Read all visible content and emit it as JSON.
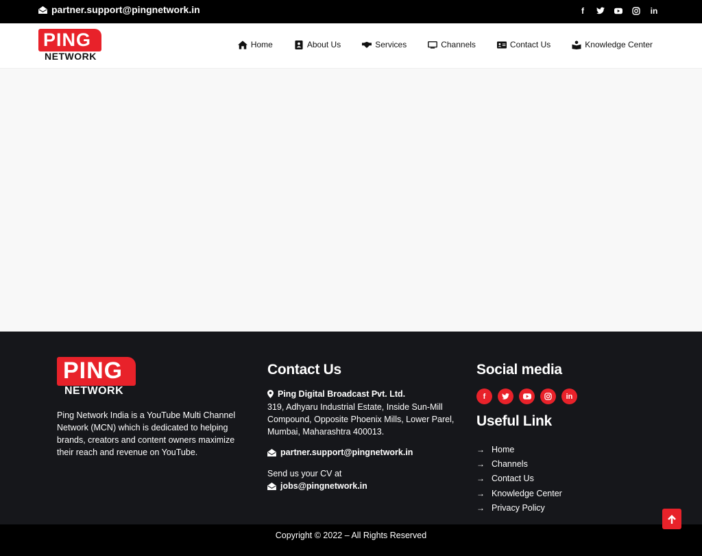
{
  "topbar": {
    "email": "partner.support@pingnetwork.in",
    "social_icons": [
      "facebook-icon",
      "twitter-icon",
      "youtube-icon",
      "instagram-icon",
      "linkedin-icon"
    ]
  },
  "logo": {
    "ping": "PING",
    "network": "NETWORK"
  },
  "nav": {
    "items": [
      {
        "label": "Home",
        "icon": "home-icon"
      },
      {
        "label": "About Us",
        "icon": "address-book-icon"
      },
      {
        "label": "Services",
        "icon": "handshake-icon"
      },
      {
        "label": "Channels",
        "icon": "tv-icon"
      },
      {
        "label": "Contact Us",
        "icon": "id-card-icon"
      },
      {
        "label": "Knowledge Center",
        "icon": "book-reader-icon"
      }
    ]
  },
  "footer": {
    "about": "Ping Network India is a YouTube Multi Channel Network (MCN) which is dedicated to helping brands, creators and content owners maximize their reach and revenue on YouTube.",
    "contact": {
      "title": "Contact Us",
      "company": "Ping Digital Broadcast Pvt. Ltd.",
      "address": "319, Adhyaru Industrial Estate, Inside Sun-Mill Compound, Opposite Phoenix Mills, Lower Parel, Mumbai, Maharashtra 400013.",
      "email": "partner.support@pingnetwork.in",
      "cv_label": "Send us your CV at",
      "cv_email": "jobs@pingnetwork.in"
    },
    "social": {
      "title": "Social media",
      "icons": [
        "facebook-icon",
        "twitter-icon",
        "youtube-icon",
        "instagram-icon",
        "linkedin-icon"
      ]
    },
    "useful": {
      "title": "Useful Link",
      "links": [
        "Home",
        "Channels",
        "Contact Us",
        "Knowledge Center",
        "Privacy Policy"
      ]
    }
  },
  "copyright": "Copyright © 2022 – All Rights Reserved",
  "colors": {
    "accent": "#e8222a",
    "footer_bg": "#16171b",
    "topbar_bg": "#000000"
  }
}
